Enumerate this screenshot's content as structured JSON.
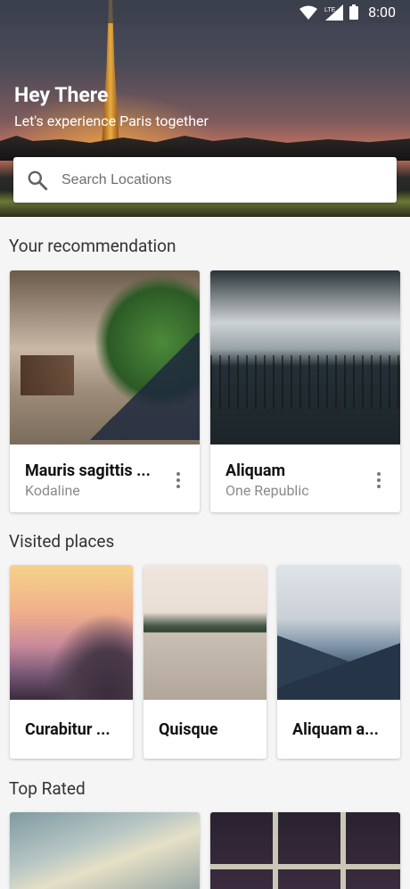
{
  "status": {
    "network": "LTE",
    "time": "8:00"
  },
  "header": {
    "title": "Hey There",
    "subtitle": "Let's experience Paris together"
  },
  "search": {
    "placeholder": "Search Locations"
  },
  "sections": {
    "recommendation": {
      "title": "Your recommendation",
      "cards": [
        {
          "title": "Mauris sagittis ...",
          "subtitle": "Kodaline",
          "image": "park-bench"
        },
        {
          "title": "Aliquam",
          "subtitle": "One Republic",
          "image": "swing-ride"
        }
      ]
    },
    "visited": {
      "title": "Visited places",
      "cards": [
        {
          "title": "Curabitur ...",
          "image": "misty-sunset"
        },
        {
          "title": "Quisque",
          "image": "wooden-pier"
        },
        {
          "title": "Aliquam a...",
          "image": "mountains"
        }
      ]
    },
    "top_rated": {
      "title": "Top Rated",
      "cards": [
        {
          "image": "book"
        },
        {
          "image": "window"
        }
      ]
    }
  },
  "icons": {
    "wifi": "wifi-icon",
    "signal": "signal-icon",
    "battery": "battery-icon",
    "search": "search-icon",
    "more": "more-vert-icon"
  }
}
